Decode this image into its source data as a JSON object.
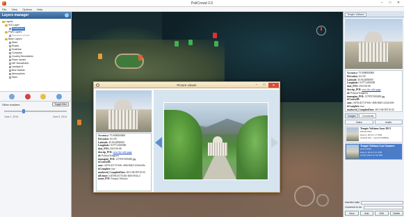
{
  "window": {
    "title": "PoliCrowd 2.0"
  },
  "menu": [
    "File",
    "View",
    "Options",
    "Help"
  ],
  "layers_manager": {
    "title": "Layers manager",
    "tree": [
      {
        "label": "Layers",
        "type": "root",
        "selected": false,
        "dim": false
      },
      {
        "label": "VGI Layer",
        "type": "folder",
        "selected": false,
        "dim": false,
        "child": true
      },
      {
        "label": "Politecnico",
        "type": "item",
        "selected": true,
        "dim": false,
        "child": true
      },
      {
        "label": "PWS Layers",
        "type": "folder",
        "selected": false,
        "dim": false,
        "child": true
      },
      {
        "label": "Semantic Weath",
        "type": "item",
        "selected": false,
        "dim": true,
        "child": true
      },
      {
        "label": "Base Layers",
        "type": "folder",
        "selected": false,
        "dim": false,
        "child": true
      },
      {
        "label": "Stars",
        "type": "item",
        "selected": false,
        "dim": false,
        "child": true
      },
      {
        "label": "Roads",
        "type": "item",
        "selected": false,
        "dim": false,
        "child": true
      },
      {
        "label": "Scalebar",
        "type": "item",
        "selected": false,
        "dim": false,
        "child": true
      },
      {
        "label": "Compass",
        "type": "item",
        "selected": false,
        "dim": false,
        "child": true
      },
      {
        "label": "Country Boundaries",
        "type": "item",
        "selected": false,
        "dim": false,
        "child": true
      },
      {
        "label": "Place names",
        "type": "item",
        "selected": false,
        "dim": false,
        "child": true
      },
      {
        "label": "MS VirtualEarth",
        "type": "item",
        "selected": false,
        "dim": false,
        "child": true
      },
      {
        "label": "Landsat I3",
        "type": "item",
        "selected": false,
        "dim": false,
        "child": true
      },
      {
        "label": "Blue Marble",
        "type": "item",
        "selected": false,
        "dim": false,
        "child": true
      },
      {
        "label": "Atmosphere",
        "type": "item",
        "selected": false,
        "dim": false,
        "child": true
      },
      {
        "label": "Stars",
        "type": "item",
        "selected": false,
        "dim": false,
        "child": true
      }
    ],
    "other_markers_label": "Other markers",
    "toggle_button": "Toggle filter",
    "slider_level": 0.3,
    "date_from": "June 1, 2014",
    "date_to": "June 3, 2014"
  },
  "right_panel": {
    "tab": "Tempio Voltiano",
    "info": [
      {
        "k": "Accuracy:",
        "v": "75.0000000000"
      },
      {
        "k": "Elevation:",
        "v": "161.00"
      },
      {
        "k": "Latitude:",
        "v": "45.8144850000"
      },
      {
        "k": "Longitude:",
        "v": "9.07712650000"
      },
      {
        "k": "date_POI:",
        "v": "2013-06-08"
      },
      {
        "k": "descrip_POI:",
        "v": "view the wiki page",
        "link": true
      },
      {
        "k": "id:",
        "v": "PoliniciTemprese"
      },
      {
        "k": "immagine_POI:",
        "v": "1370767003288.jpg"
      },
      {
        "k": "isCourseID:",
        "v": ""
      },
      {
        "k": "osm:",
        "v": "c6f76c41174-9c8c-40fb-8d43-223cb3e9e"
      },
      {
        "k": "isComplete:",
        "v": "true"
      },
      {
        "k": "markerid_CompleteDate:",
        "v": "2013-06-09T10:50"
      },
      {
        "k": "idUtente:",
        "v": "e4f749f41174-4fb-40fb-0041c2"
      },
      {
        "k": "nome_POI:",
        "v": "Tempio Voltiano"
      }
    ],
    "tabs": [
      "Images",
      "Comments"
    ],
    "buttons": [
      "Video",
      "Audio"
    ],
    "comments": [
      {
        "title": "Tempio Voltiano June 2013",
        "author": "ilarioacasbe",
        "date": "June 2, 2014 1:17 PM",
        "text": "A great trip - a good building",
        "selected": false
      },
      {
        "title": "Tempio Voltiano Last Summer",
        "author": "sterrovanib",
        "date": "June 2, 2014 1:21 PM",
        "text": "A nice place to see this",
        "selected": true
      }
    ],
    "fields": [
      "Insertion date",
      "Comment to be:"
    ],
    "action_buttons": [
      "View",
      "Add",
      "Edit",
      "Delete"
    ]
  },
  "picture_viewer": {
    "title": "Picture viewer",
    "info": [
      {
        "k": "Accuracy:",
        "v": "75.0000000000"
      },
      {
        "k": "Elevation:",
        "v": "161.00"
      },
      {
        "k": "Latitude:",
        "v": "45.8144850000"
      },
      {
        "k": "Longitude:",
        "v": "9.07712650000"
      },
      {
        "k": "date_POI:",
        "v": "2013-06-08"
      },
      {
        "k": "descrip_POI:",
        "v": "view the wiki page",
        "link": true
      },
      {
        "k": "id:",
        "v": "PoliniciTemprese"
      },
      {
        "k": "immagine_POI:",
        "v": "1370767003288.jpg"
      },
      {
        "k": "isCourseID:",
        "v": ""
      },
      {
        "k": "osm:",
        "v": "c6f76c41174-9c8c-40fb-8d43-223cb3e9e"
      },
      {
        "k": "isComplete:",
        "v": "true"
      },
      {
        "k": "markerid_CompleteDate:",
        "v": "2013-06-09T10:50"
      },
      {
        "k": "idUtente:",
        "v": "e4f749f41174-4fb-40fb-0041c2"
      },
      {
        "k": "nome_POI:",
        "v": "Tempio Voltiano"
      }
    ]
  },
  "colors": {
    "accent": "#3b79c8",
    "close": "#d84a3a",
    "dialog_border": "#c9a46a"
  }
}
